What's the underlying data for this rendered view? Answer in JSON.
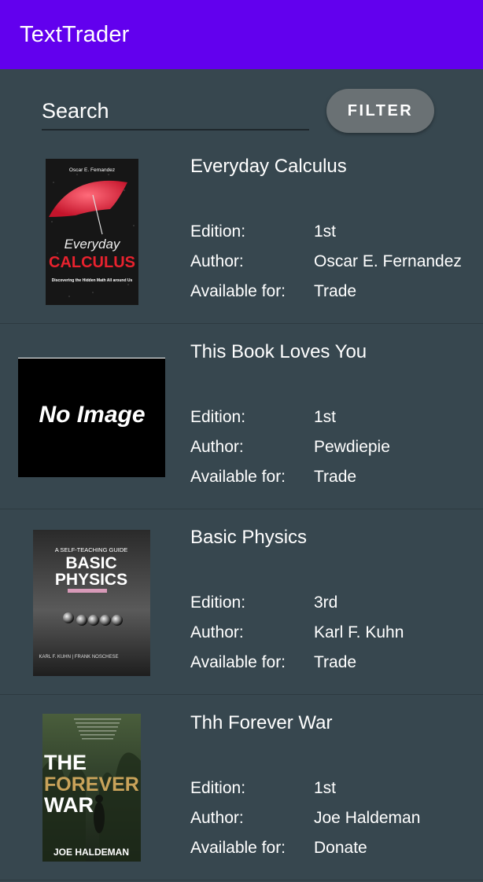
{
  "app": {
    "title": "TextTrader"
  },
  "search": {
    "placeholder": "Search",
    "value": ""
  },
  "filter_button": {
    "label": "FILTER"
  },
  "labels": {
    "edition": "Edition:",
    "author": "Author:",
    "available": "Available for:"
  },
  "books": [
    {
      "title": "Everyday Calculus",
      "edition": "1st",
      "author": "Oscar E. Fernandez",
      "available": "Trade",
      "cover": {
        "author_text": "Oscar E. Fernandez",
        "title_line1": "Everyday",
        "title_line2": "CALCULUS",
        "subtitle": "Discovering the Hidden Math All around Us"
      }
    },
    {
      "title": "This Book Loves You",
      "edition": "1st",
      "author": "Pewdiepie",
      "available": "Trade",
      "cover": {
        "placeholder_text": "No Image"
      }
    },
    {
      "title": "Basic Physics",
      "edition": "3rd",
      "author": "Karl F. Kuhn",
      "available": "Trade",
      "cover": {
        "tagline": "A SELF-TEACHING GUIDE",
        "title_line1": "BASIC",
        "title_line2": "PHYSICS",
        "authors_text": "KARL F. KUHN | FRANK NOSCHESE"
      }
    },
    {
      "title": "Thh Forever War",
      "edition": "1st",
      "author": "Joe Haldeman",
      "available": "Donate",
      "cover": {
        "title_line1": "THE",
        "title_line2": "FOREVER",
        "title_line3": "WAR",
        "author_text": "JOE HALDEMAN"
      }
    }
  ],
  "colors": {
    "app_bar": "#6200ee",
    "background": "#37474f",
    "filter_button": "#6a7174",
    "text": "#ffffff"
  }
}
